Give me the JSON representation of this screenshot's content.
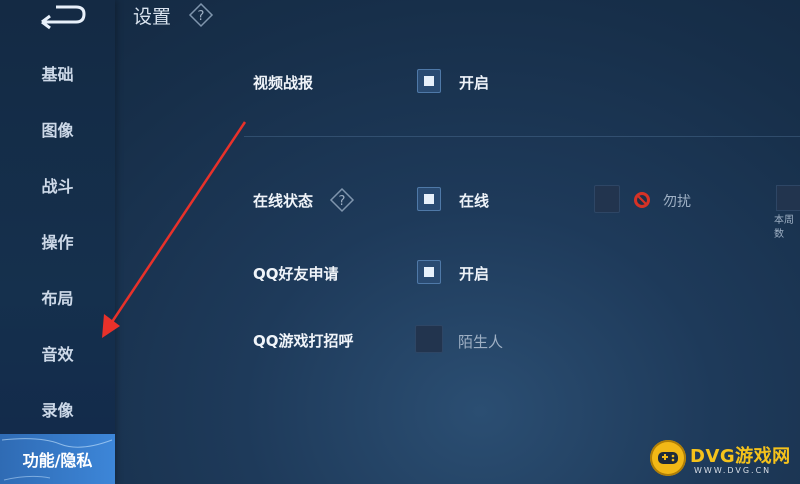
{
  "header": {
    "title": "设置"
  },
  "sidebar": {
    "items": [
      {
        "label": "基础"
      },
      {
        "label": "图像"
      },
      {
        "label": "战斗"
      },
      {
        "label": "操作"
      },
      {
        "label": "布局"
      },
      {
        "label": "音效"
      },
      {
        "label": "录像"
      },
      {
        "label": "功能/隐私",
        "active": true
      }
    ]
  },
  "settings": {
    "video_report": {
      "label": "视频战报",
      "option": "开启",
      "checked": true
    },
    "online_status": {
      "label": "在线状态",
      "options": [
        {
          "label": "在线",
          "checked": true
        },
        {
          "label": "勿扰",
          "checked": false
        }
      ],
      "cut_text": "本周\n数"
    },
    "qq_friend_request": {
      "label": "QQ好友申请",
      "option": "开启",
      "checked": true
    },
    "qq_game_greeting": {
      "label": "QQ游戏打招呼",
      "option": "陌生人",
      "checked": false
    }
  },
  "watermark": {
    "title": "DVG游戏网",
    "url": "WWW.DVG.CN"
  },
  "colors": {
    "accent": "#3d86d8",
    "annotation_arrow": "#e8312a",
    "watermark": "#f5c21b"
  }
}
